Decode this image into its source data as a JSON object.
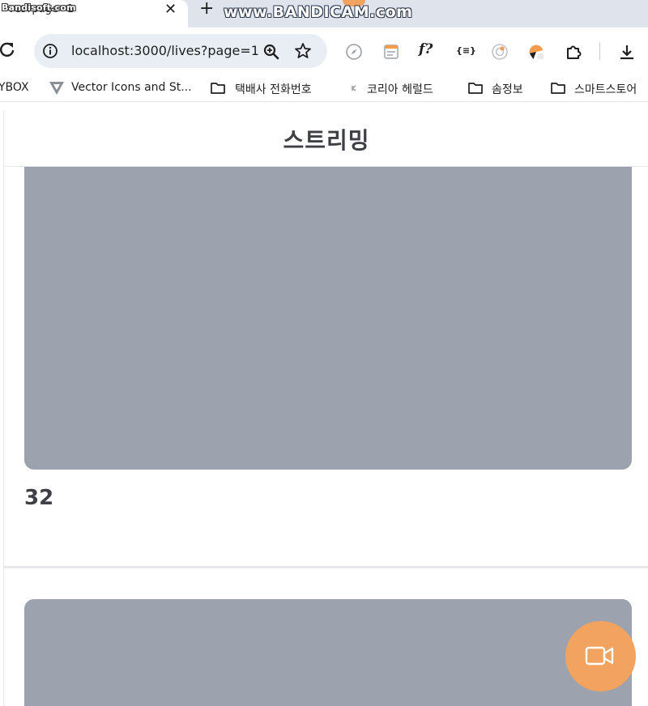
{
  "browser": {
    "tab": {
      "title": "ves?page=1",
      "close": "✕"
    },
    "new_tab": "+",
    "watermarks": {
      "left": "Bandisoft.com",
      "main": "www.BANDICAM.com"
    },
    "address": {
      "url": "localhost:3000/lives?page=1"
    },
    "bookmarks": [
      {
        "label": "YBOX",
        "icon": "none"
      },
      {
        "label": "Vector Icons and St...",
        "icon": "vector-logo-icon"
      },
      {
        "label": "택배사 전화번호",
        "icon": "folder-icon"
      },
      {
        "label": "코리아 헤럴드",
        "icon": "site-favicon-icon"
      },
      {
        "label": "솜정보",
        "icon": "folder-icon"
      },
      {
        "label": "스마트스토어",
        "icon": "folder-icon"
      }
    ]
  },
  "page": {
    "title": "스트리밍",
    "streams": [
      {
        "id": "32"
      },
      {
        "id": ""
      }
    ],
    "fab": {
      "icon": "video-camera-icon",
      "color": "#f2a35f"
    }
  },
  "colors": {
    "thumbnail": "#9ca3af",
    "accent": "#f2a35f",
    "chrome_tabstrip": "#dfe3eb",
    "omnibox": "#e9edf4"
  }
}
